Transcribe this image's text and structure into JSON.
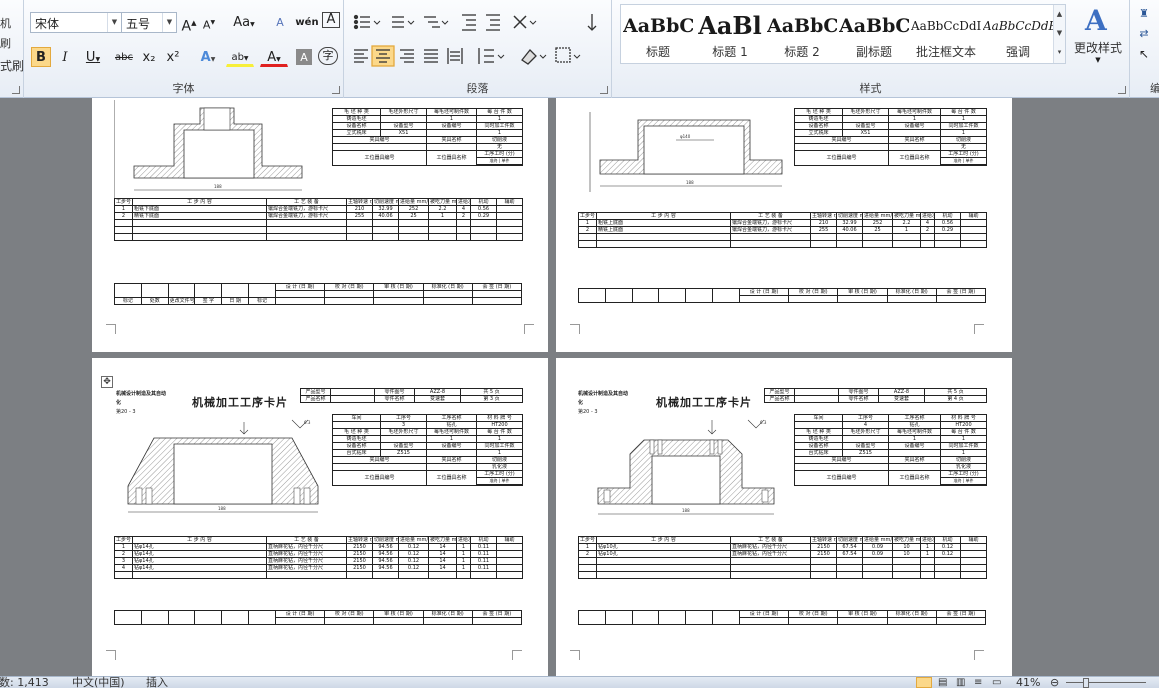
{
  "clipboard": {
    "fragments": [
      "机",
      "刷",
      "式刷"
    ]
  },
  "font": {
    "label": "字体",
    "name": "宋体",
    "size": "五号",
    "buttons": {
      "grow": "A",
      "shrink": "A",
      "change_case": "Aa",
      "clear": "A",
      "pinyin": "wén",
      "border": "A",
      "bold": "B",
      "italic": "I",
      "underline": "U",
      "strike": "abc",
      "subscript": "x₂",
      "superscript": "x²",
      "effects": "A",
      "highlight": "ab",
      "color": "A",
      "shading": "A",
      "enclose": "字"
    }
  },
  "paragraph": {
    "label": "段落"
  },
  "styles": {
    "label": "样式",
    "items": [
      {
        "sample": "AaBbC",
        "name": "标题"
      },
      {
        "sample": "AaBl",
        "name": "标题 1"
      },
      {
        "sample": "AaBbC",
        "name": "标题 2"
      },
      {
        "sample": "AaBbC",
        "name": "副标题"
      },
      {
        "sample": "AaBbCcDdI",
        "name": "批注框文本"
      },
      {
        "sample": "AaBbCcDdE",
        "name": "强调"
      }
    ],
    "change_styles": "更改样式"
  },
  "editing": {
    "label": "编"
  },
  "card": {
    "head_left": "机械设计制造及其自动化",
    "head_sub": "第20  -  3",
    "title": "机械加工工序卡片",
    "product_model": "产品型号",
    "product_name": "产品名称",
    "part_no_label": "零件图号",
    "part_no": "AZZ-8",
    "part_name_label": "零件名称",
    "part_name": "变速套",
    "total_pages": "共 5 页",
    "page_3": "第 3 页",
    "page_4": "第 4 页",
    "workshop": "车间",
    "process_no": "工序号",
    "process_name": "工序名称",
    "material_label": "材 料 牌 号",
    "process_no_3": "3",
    "process_no_4": "4",
    "drill": "钻孔",
    "material": "HT200",
    "blank_type": "毛 坯 种 类",
    "blank_dim": "毛坯外形尺寸",
    "blank_count": "每毛坯可制件数",
    "per_unit": "每 台 件 数",
    "casting": "铸造毛坯",
    "one": "1",
    "equip_name": "设备名称",
    "equip_model": "设备型号",
    "equip_no": "设备编号",
    "simul": "同时加工件数",
    "vertical_mill": "立式铣床",
    "x51": "X51",
    "bench_drill": "台式钻床",
    "z515": "Z515",
    "fixture_no": "夹具编号",
    "fixture_name": "夹具名称",
    "coolant": "切削液",
    "none": "无",
    "emulsion": "乳化液",
    "station_no": "工位器具编号",
    "station_name": "工位器具名称",
    "time_label": "工序工时 (分)",
    "time_std": "准终",
    "time_unit": "单件",
    "step_no": "工步号",
    "step_content": "工    步    内    容",
    "equip_process": "工  艺  装  备",
    "spindle": "主轴转速 r/min",
    "cut_speed": "切削速度 m/min",
    "feed": "进给量 mm/r",
    "depth": "被吃刀量 mm",
    "passes": "进给次数",
    "hours": "工时/min",
    "mach": "机动",
    "aux": "辅助",
    "sign_design": "设 计 (日 期)",
    "sign_check": "校 对 (日 期)",
    "sign_review": "审 核 (日 期)",
    "sign_std": "标准化 (日 期)",
    "sign_approve": "会 签 (日 期)",
    "rev_mark": "标记",
    "rev_count": "处数",
    "rev_doc": "更改文件号",
    "rev_sign": "签 字",
    "rev_date": "日 期"
  },
  "steps": {
    "p1": [
      {
        "no": "1",
        "content": "粗铣下底面",
        "tool": "镶焊合金端铣刀，游标卡尺",
        "spindle": "210",
        "speed": "32.99",
        "feed": "252",
        "depth": "2.2",
        "passes": "4",
        "time": "0.56"
      },
      {
        "no": "2",
        "content": "精铣下底面",
        "tool": "镶焊合金端铣刀，游标卡尺",
        "spindle": "255",
        "speed": "40.06",
        "feed": "25",
        "depth": "1",
        "passes": "2",
        "time": "0.29"
      }
    ],
    "p2": [
      {
        "no": "1",
        "content": "粗铣上底面",
        "tool": "镶焊合金端铣刀，游标卡尺",
        "spindle": "210",
        "speed": "32.99",
        "feed": "252",
        "depth": "2.2",
        "passes": "4",
        "time": "0.56"
      },
      {
        "no": "2",
        "content": "精铣上底面",
        "tool": "镶焊合金端铣刀，游标卡尺",
        "spindle": "255",
        "speed": "40.06",
        "feed": "25",
        "depth": "1",
        "passes": "2",
        "time": "0.29"
      }
    ],
    "p3": [
      {
        "no": "1",
        "content": "钻φ14孔",
        "tool": "直柄麻花钻，内径千分尺",
        "spindle": "2150",
        "speed": "94.56",
        "feed": "0.12",
        "depth": "14",
        "passes": "1",
        "time": "0.11"
      },
      {
        "no": "2",
        "content": "钻φ14孔",
        "tool": "直柄麻花钻，内径千分尺",
        "spindle": "2150",
        "speed": "94.56",
        "feed": "0.12",
        "depth": "14",
        "passes": "1",
        "time": "0.11"
      },
      {
        "no": "3",
        "content": "钻φ14孔",
        "tool": "直柄麻花钻，内径千分尺",
        "spindle": "2150",
        "speed": "94.56",
        "feed": "0.12",
        "depth": "14",
        "passes": "1",
        "time": "0.11"
      },
      {
        "no": "4",
        "content": "钻φ14孔",
        "tool": "直柄麻花钻，内径千分尺",
        "spindle": "2150",
        "speed": "94.56",
        "feed": "0.12",
        "depth": "14",
        "passes": "1",
        "time": "0.11"
      }
    ],
    "p4": [
      {
        "no": "1",
        "content": "钻φ10孔",
        "tool": "直柄麻花钻，内径千分尺",
        "spindle": "2150",
        "speed": "67.54",
        "feed": "0.09",
        "depth": "10",
        "passes": "1",
        "time": "0.12"
      },
      {
        "no": "2",
        "content": "钻φ10孔",
        "tool": "直柄麻花钻，内径千分尺",
        "spindle": "2150",
        "speed": "67.54",
        "feed": "0.09",
        "depth": "10",
        "passes": "1",
        "time": "0.12"
      }
    ]
  },
  "statusbar": {
    "words": "字数: 1,413",
    "language": "中文(中国)",
    "mode": "插入",
    "zoom": "41%"
  }
}
